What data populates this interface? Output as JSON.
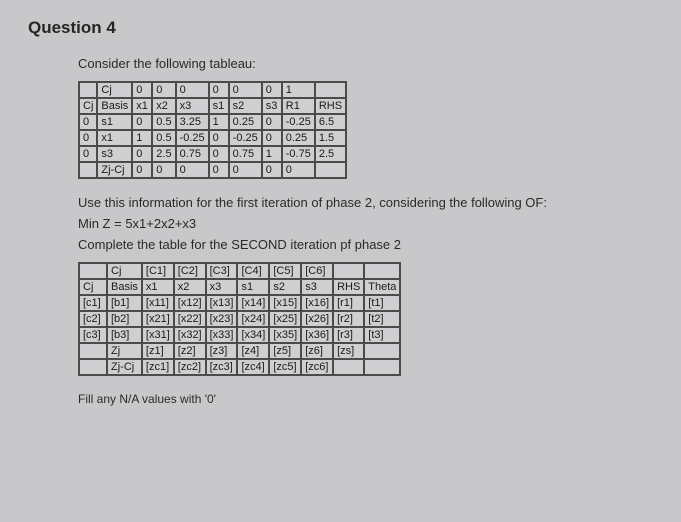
{
  "question_label": "Question 4",
  "intro": "Consider the following tableau:",
  "tableau1": {
    "r0": [
      "",
      "Cj",
      "0",
      "0",
      "0",
      "0",
      "0",
      "0",
      "1",
      ""
    ],
    "r1": [
      "Cj",
      "Basis",
      "x1",
      "x2",
      "x3",
      "s1",
      "s2",
      "s3",
      "R1",
      "RHS"
    ],
    "r2": [
      "0",
      "s1",
      "0",
      "0.5",
      "3.25",
      "1",
      "0.25",
      "0",
      "-0.25",
      "6.5"
    ],
    "r3": [
      "0",
      "x1",
      "1",
      "0.5",
      "-0.25",
      "0",
      "-0.25",
      "0",
      "0.25",
      "1.5"
    ],
    "r4": [
      "0",
      "s3",
      "0",
      "2.5",
      "0.75",
      "0",
      "0.75",
      "1",
      "-0.75",
      "2.5"
    ],
    "r5": [
      "",
      "Zj-Cj",
      "0",
      "0",
      "0",
      "0",
      "0",
      "0",
      "0",
      ""
    ]
  },
  "line1": "Use this information for the first iteration of phase 2, considering the following OF:",
  "line2": "Min Z = 5x1+2x2+x3",
  "line3": "Complete the table for the SECOND iteration pf phase 2",
  "tableau2": {
    "r0": [
      "",
      "Cj",
      "[C1]",
      "[C2]",
      "[C3]",
      "[C4]",
      "[C5]",
      "[C6]",
      "",
      ""
    ],
    "r1": [
      "Cj",
      "Basis",
      "x1",
      "x2",
      "x3",
      "s1",
      "s2",
      "s3",
      "RHS",
      "Theta"
    ],
    "r2": [
      "[c1]",
      "[b1]",
      "[x11]",
      "[x12]",
      "[x13]",
      "[x14]",
      "[x15]",
      "[x16]",
      "[r1]",
      "[t1]"
    ],
    "r3": [
      "[c2]",
      "[b2]",
      "[x21]",
      "[x22]",
      "[x23]",
      "[x24]",
      "[x25]",
      "[x26]",
      "[r2]",
      "[t2]"
    ],
    "r4": [
      "[c3]",
      "[b3]",
      "[x31]",
      "[x32]",
      "[x33]",
      "[x34]",
      "[x35]",
      "[x36]",
      "[r3]",
      "[t3]"
    ],
    "r5": [
      "",
      "Zj",
      "[z1]",
      "[z2]",
      "[z3]",
      "[z4]",
      "[z5]",
      "[z6]",
      "[zs]",
      ""
    ],
    "r6": [
      "",
      "Zj-Cj",
      "[zc1]",
      "[zc2]",
      "[zc3]",
      "[zc4]",
      "[zc5]",
      "[zc6]",
      "",
      ""
    ]
  },
  "fillnote": "Fill any N/A values with '0'"
}
